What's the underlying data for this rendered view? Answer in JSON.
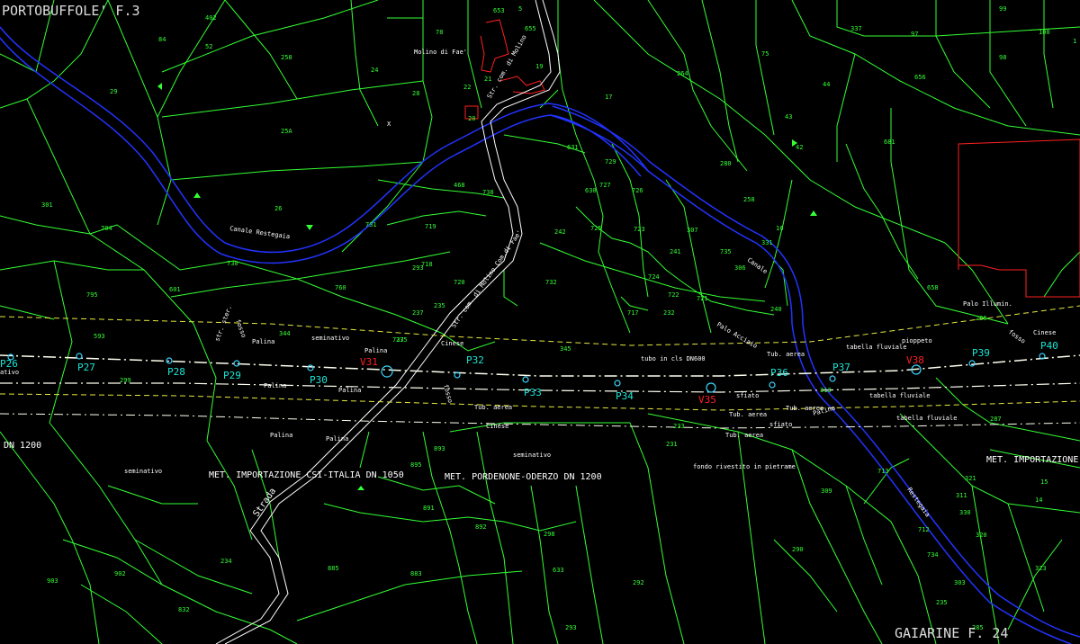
{
  "sheet_titles": {
    "top_left": "PORTOBUFFOLE' F.3",
    "bottom_right": "GAIARINE   F. 24"
  },
  "parcel_numbers": [
    "402",
    "84",
    "52",
    "258",
    "29",
    "25A",
    "26",
    "301",
    "704",
    "730",
    "795",
    "601",
    "593",
    "299",
    "24",
    "28",
    "78",
    "22",
    "20",
    "17",
    "264",
    "631",
    "729",
    "468",
    "738",
    "630",
    "727",
    "726",
    "731",
    "719",
    "242",
    "725",
    "723",
    "241",
    "307",
    "718",
    "760",
    "720",
    "732",
    "724",
    "722",
    "721",
    "717",
    "237",
    "235",
    "235",
    "344",
    "345",
    "293",
    "293",
    "633",
    "232",
    "75",
    "43",
    "42",
    "44",
    "656",
    "681",
    "280",
    "258",
    "16",
    "331",
    "306",
    "735",
    "240",
    "658",
    "266",
    "99",
    "100",
    "98",
    "97",
    "337",
    "1",
    "233",
    "737",
    "5",
    "19",
    "21",
    "653",
    "655",
    "893",
    "895",
    "891",
    "892",
    "885",
    "883",
    "298",
    "292",
    "290",
    "313",
    "309",
    "321",
    "311",
    "330",
    "320",
    "323",
    "231",
    "235",
    "285",
    "287",
    "15",
    "14",
    "713",
    "712",
    "734",
    "303",
    "234",
    "902",
    "903",
    "832"
  ],
  "station_labels": [
    "P26",
    "P27",
    "P28",
    "P29",
    "P30",
    "V31",
    "P32",
    "P33",
    "P34",
    "V35",
    "P36",
    "P37",
    "V38",
    "P39",
    "P40"
  ],
  "text_labels": {
    "molino": "Molino di Fae'",
    "canale_top": "Canale Restegaia",
    "strada_com_top": "Str. com. di Molino",
    "strada_com_mid": "Str. com. di Molino Com.di Fae'",
    "canale_right": "Canale",
    "fosso_left": "fosso",
    "str_ster": "str. ster.",
    "palina_1": "Palina",
    "palina_2": "Palina",
    "palina_3": "Palina",
    "palina_4": "Palina",
    "palina_5": "Palina",
    "palina_6": "Palina",
    "seminativo_1": "seminativo",
    "seminativo_2": "seminativo",
    "seminativo_3": "seminativo",
    "cinese_1": "Cinese",
    "cinese_2": "Cinese",
    "cinese_3": "Cinese",
    "fosso_mid": "fosso",
    "tub_aerea_1": "Tub. aerea",
    "tub_aerea_2": "Tub. aerea",
    "tub_aerea_3": "Tub. aerea",
    "tub_aerea_4": "Tub. aerea",
    "tubo_cls": "tubo in cls DN600",
    "pali_acciaio": "Palo Acciaio",
    "sfiato_1": "sfiato",
    "sfiato_2": "sfiato",
    "tabella_1": "tabella fluviale",
    "tabella_2": "tabella fluviale",
    "tabella_3": "tabella fluviale",
    "fondo": "fondo rivestito in pietrame",
    "pioppeto": "pioppeto",
    "palo_illum": "Palo Illumin.",
    "fosso_right": "fosso",
    "restegaia_right": "Restegaia",
    "palina_right": "Palina",
    "dn1200_left": "DN 1200",
    "met_csi": "MET. IMPORTAZIONE CSI-ITALIA   DN 1050",
    "met_pn": "MET. PORDENONE-ODERZO   DN 1200",
    "met_imp_right": "MET. IMPORTAZIONE",
    "strada_bottom": "Strada",
    "ativo": "ativo",
    "x_mark": "X",
    "tub_aerea_5": "Tub. aerea"
  },
  "colors": {
    "background": "#000000",
    "parcel_lines": "#33ff33",
    "canal": "#2233ff",
    "road": "#ffffff",
    "pipeline_axis": "#ffffee",
    "pipeline_dashed": "#e8e840",
    "station": "#3ad6ff",
    "station_label": "#19e6d6",
    "red_station_label": "#ff2020",
    "building": "#ff2020",
    "title_text": "#dddddd"
  }
}
